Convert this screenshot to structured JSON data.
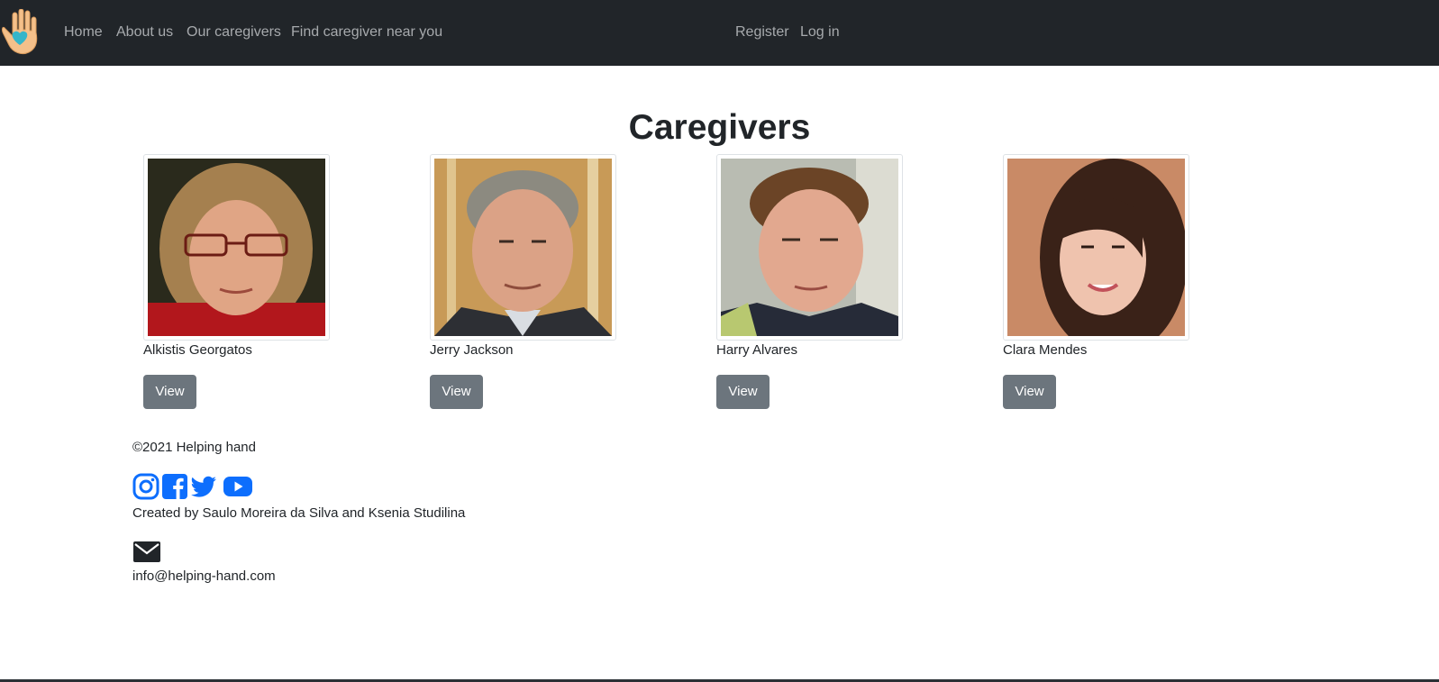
{
  "nav": {
    "logo_icon": "raised-hand-heart-icon",
    "links": [
      {
        "label": "Home"
      },
      {
        "label": "About us"
      },
      {
        "label": "Our caregivers"
      },
      {
        "label": "Find caregiver near you"
      }
    ],
    "auth": [
      {
        "label": "Register"
      },
      {
        "label": "Log in"
      }
    ]
  },
  "main": {
    "title": "Caregivers",
    "caregivers": [
      {
        "name": "Alkistis Georgatos",
        "button": "View"
      },
      {
        "name": "Jerry Jackson",
        "button": "View"
      },
      {
        "name": "Harry Alvares",
        "button": "View"
      },
      {
        "name": "Clara Mendes",
        "button": "View"
      }
    ]
  },
  "footer": {
    "copyright": "©2021 Helping hand",
    "social_icons": [
      "instagram-icon",
      "facebook-icon",
      "twitter-icon",
      "youtube-icon"
    ],
    "credit": "Created by Saulo Moreira da Silva and Ksenia Studilina",
    "email": "info@helping-hand.com"
  },
  "colors": {
    "navbar_bg": "#212529",
    "nav_link": "#a7aaad",
    "button_bg": "#6c757d",
    "social_blue": "#0d6efd"
  }
}
